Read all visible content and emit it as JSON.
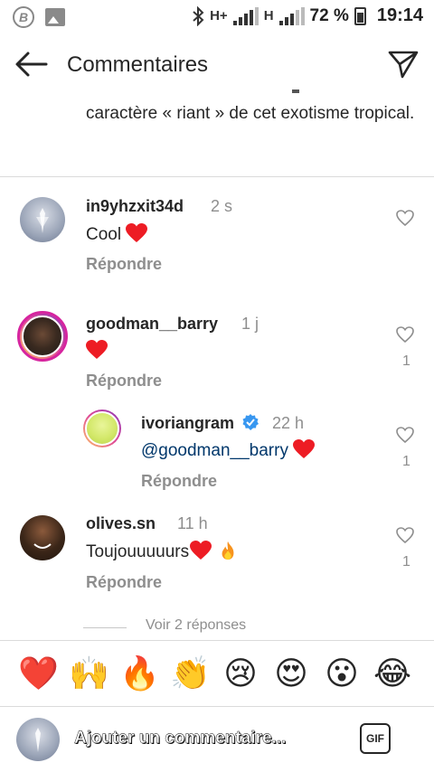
{
  "status_bar": {
    "circle_icon": "B",
    "bluetooth_icon": "bluetooth-icon",
    "network1": "H+",
    "network2": "H",
    "battery_pct": "72 %",
    "time": "19:14"
  },
  "header": {
    "title": "Commentaires",
    "back_icon": "arrow-left-icon",
    "send_icon": "paper-plane-icon"
  },
  "caption": {
    "text": "caractère « riant » de cet exotisme tropical."
  },
  "comments": [
    {
      "username": "in9yhzxit34d",
      "time": "2 s",
      "text": "Cool",
      "reply": "Répondre",
      "likes": ""
    },
    {
      "username": "goodman__barry",
      "time": "1 j",
      "text": "",
      "reply": "Répondre",
      "likes": "1"
    },
    {
      "username": "ivoriangram",
      "time": "22 h",
      "mention": "@goodman__barry",
      "reply": "Répondre",
      "likes": "1",
      "verified": true
    },
    {
      "username": "olives.sn",
      "time": "11 h",
      "text": "Toujouuuuurs",
      "reply": "Répondre",
      "likes": "1"
    }
  ],
  "view_replies": "Voir 2 réponses",
  "emoji_bar": [
    "❤️",
    "🙌",
    "🔥",
    "👏",
    "😢",
    "😍",
    "😮",
    "😂"
  ],
  "input": {
    "placeholder": "Ajouter un commentaire...",
    "gif_label": "GIF"
  },
  "colors": {
    "text": "#262626",
    "muted": "#8e8e8e",
    "mention": "#00376b",
    "heart": "#ed1c24",
    "verified": "#3897f0"
  }
}
